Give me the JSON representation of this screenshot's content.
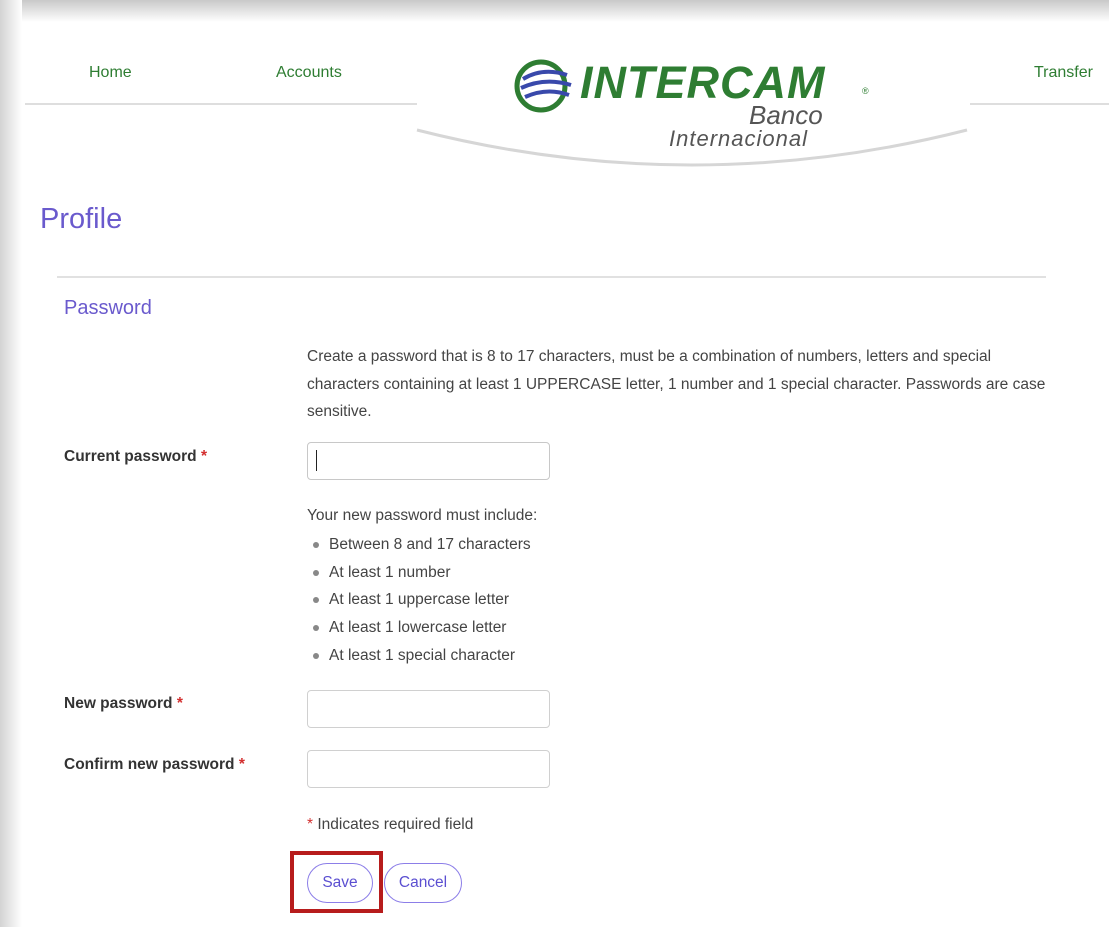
{
  "nav": {
    "home": "Home",
    "accounts": "Accounts",
    "transfer": "Transfer"
  },
  "logo": {
    "brand": "INTERCAM",
    "registered": "®",
    "line1": "Banco",
    "line2": "Internacional",
    "brand_color": "#2e7d32",
    "globe_colors": [
      "#2e7d32",
      "#3949ab"
    ]
  },
  "page": {
    "title": "Profile"
  },
  "section": {
    "title": "Password",
    "description": "Create a password that is 8 to 17 characters,  must be a combination of numbers, letters and special characters containing at least 1 UPPERCASE letter, 1 number and 1 special character. Passwords are case sensitive."
  },
  "fields": {
    "current_label": "Current password",
    "new_label": "New password",
    "confirm_label": "Confirm new password",
    "required_mark": "*"
  },
  "rules": {
    "title": "Your new password must include:",
    "items": [
      "Between 8 and 17 characters",
      "At least 1 number",
      "At least 1 uppercase letter",
      "At least 1 lowercase letter",
      "At least 1 special character"
    ]
  },
  "required_note": {
    "mark": "*",
    "text": "Indicates required field"
  },
  "buttons": {
    "save": "Save",
    "cancel": "Cancel"
  },
  "colors": {
    "accent": "#6a5acd",
    "required": "#d32f2f",
    "highlight": "#b71c1c"
  }
}
